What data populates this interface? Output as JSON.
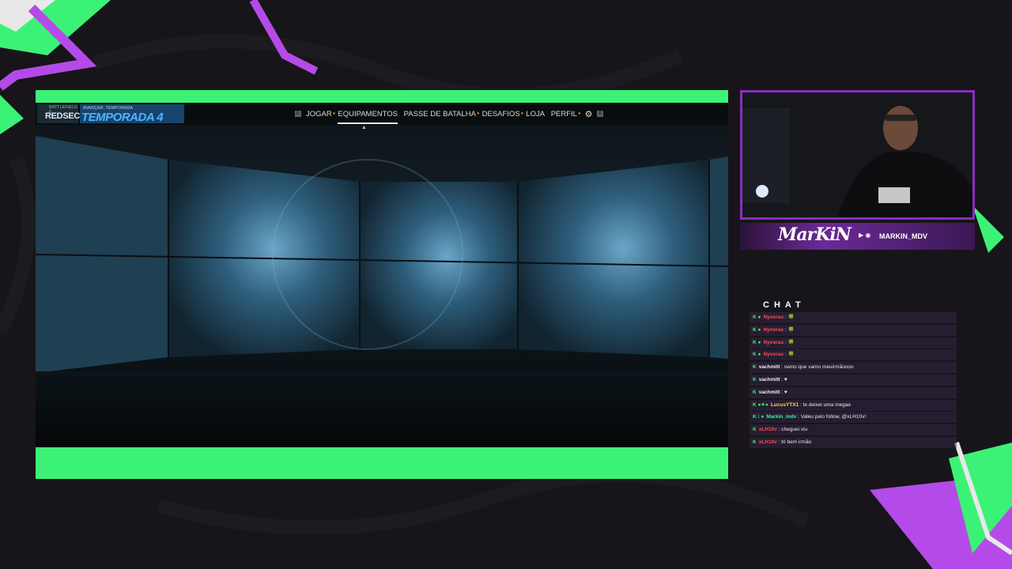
{
  "game": {
    "logo_sub": "BATTLEFIELD 6",
    "logo": "REDSEC",
    "season_sub": "AVANÇAR: TEMPORADA",
    "season_title": "TEMPORADA 4",
    "nav_key_left": "E",
    "nav_key_right": "E",
    "nav": [
      "JOGAR",
      "EQUIPAMENTOS",
      "PASSE DE BATALHA",
      "DESAFIOS",
      "LOJA",
      "PERFIL"
    ],
    "active_tab": "EQUIPAMENTOS",
    "gear_icon": "gear-icon"
  },
  "streamer": {
    "logo": "MarKiN",
    "handle": "MARKIN_MDV"
  },
  "chat": {
    "title": "CHAT",
    "messages": [
      {
        "badges": "K ●",
        "user": "Nyvoras",
        "text": ": 🍀",
        "color": "#ff4d4d"
      },
      {
        "badges": "K ●",
        "user": "Nyvoras",
        "text": ": 🍀",
        "color": "#ff4d4d"
      },
      {
        "badges": "K ●",
        "user": "Nyvoras",
        "text": ": 🍀",
        "color": "#ff4d4d"
      },
      {
        "badges": "K ●",
        "user": "Nyvoras",
        "text": ": 🍀",
        "color": "#ff4d4d"
      },
      {
        "badges": "K",
        "user": "vachmitt",
        "text": ": vamo que vamo meuirmãoooo",
        "color": "#f0f0f0"
      },
      {
        "badges": "K",
        "user": "vachmitt",
        "text": ": ♥",
        "color": "#f0f0f0"
      },
      {
        "badges": "K",
        "user": "vachmitt",
        "text": ": ♥",
        "color": "#f0f0f0"
      },
      {
        "badges": "K ●✦●",
        "user": "LucusYTX1",
        "text": ": te deixei uma megae",
        "color": "#ffd24d"
      },
      {
        "badges": "K ⁞ ●",
        "user": "Markin_mdv",
        "text": ": Valeu pelo follow, @xLH10v!",
        "color": "#3cf2a0"
      },
      {
        "badges": "K",
        "user": "xLH10v",
        "text": ": cheguei viu",
        "color": "#ff4d4d"
      },
      {
        "badges": "K",
        "user": "xLH10v",
        "text": ": tô bem irmão",
        "color": "#ff4d4d"
      }
    ]
  },
  "colors": {
    "green_frame": "#3cf276",
    "purple_accent": "#8a2dbf",
    "game_orange_dot": "#e07b25",
    "season_blue": "#4fb4ff"
  }
}
